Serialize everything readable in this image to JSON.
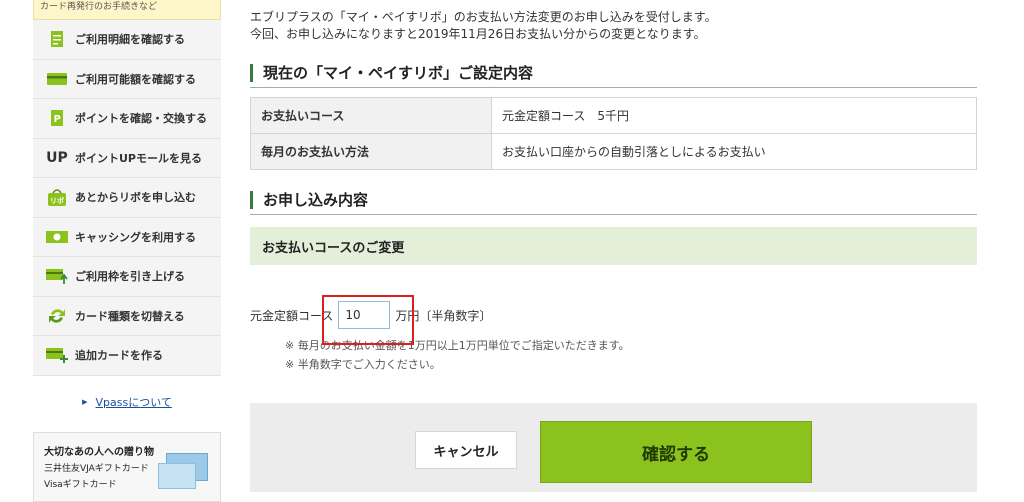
{
  "sidebar": {
    "top_text": "カード再発行のお手続きなど",
    "items": [
      {
        "label": "ご利用明細を確認する",
        "icon": "statement-icon"
      },
      {
        "label": "ご利用可能額を確認する",
        "icon": "card-icon"
      },
      {
        "label": "ポイントを確認・交換する",
        "icon": "point-icon"
      },
      {
        "label": "ポイントUPモールを見る",
        "icon": "up-mall-icon"
      },
      {
        "label": "あとからリボを申し込む",
        "icon": "revo-bag-icon"
      },
      {
        "label": "キャッシングを利用する",
        "icon": "cash-icon"
      },
      {
        "label": "ご利用枠を引き上げる",
        "icon": "limit-up-icon"
      },
      {
        "label": "カード種類を切替える",
        "icon": "switch-card-icon"
      },
      {
        "label": "追加カードを作る",
        "icon": "add-card-icon"
      }
    ],
    "up_text": "UP",
    "revo_text": "リボ",
    "vpass_link": "Vpassについて",
    "banner": {
      "line1": "大切なあの人への贈り物",
      "line2": "三井住友VJAギフトカード",
      "line3": "Visaギフトカード"
    }
  },
  "main": {
    "intro_line1": "エブリプラスの「マイ・ペイすリボ」のお支払い方法変更のお申し込みを受付します。",
    "intro_line2": "今回、お申し込みになりますと2019年11月26日お支払い分からの変更となります。",
    "current_heading": "現在の「マイ・ペイすリボ」ご設定内容",
    "current_table": [
      {
        "label": "お支払いコース",
        "value": "元金定額コース　5千円"
      },
      {
        "label": "毎月のお支払い方法",
        "value": "お支払い口座からの自動引落としによるお支払い"
      }
    ],
    "apply_heading": "お申し込み内容",
    "subsection_title": "お支払いコースのご変更",
    "form": {
      "label": "元金定額コース",
      "value": "10",
      "unit": "万円〔半角数字〕"
    },
    "notes": [
      "※ 毎月のお支払い金額を1万円以上1万円単位でご指定いただきます。",
      "※ 半角数字でご入力ください。"
    ],
    "buttons": {
      "cancel": "キャンセル",
      "confirm": "確認する"
    }
  },
  "colors": {
    "accent_green": "#8cc21e",
    "heading_bar": "#3a7a3a",
    "highlight_red": "#d8201f",
    "sub_bg": "#e4efd9"
  }
}
